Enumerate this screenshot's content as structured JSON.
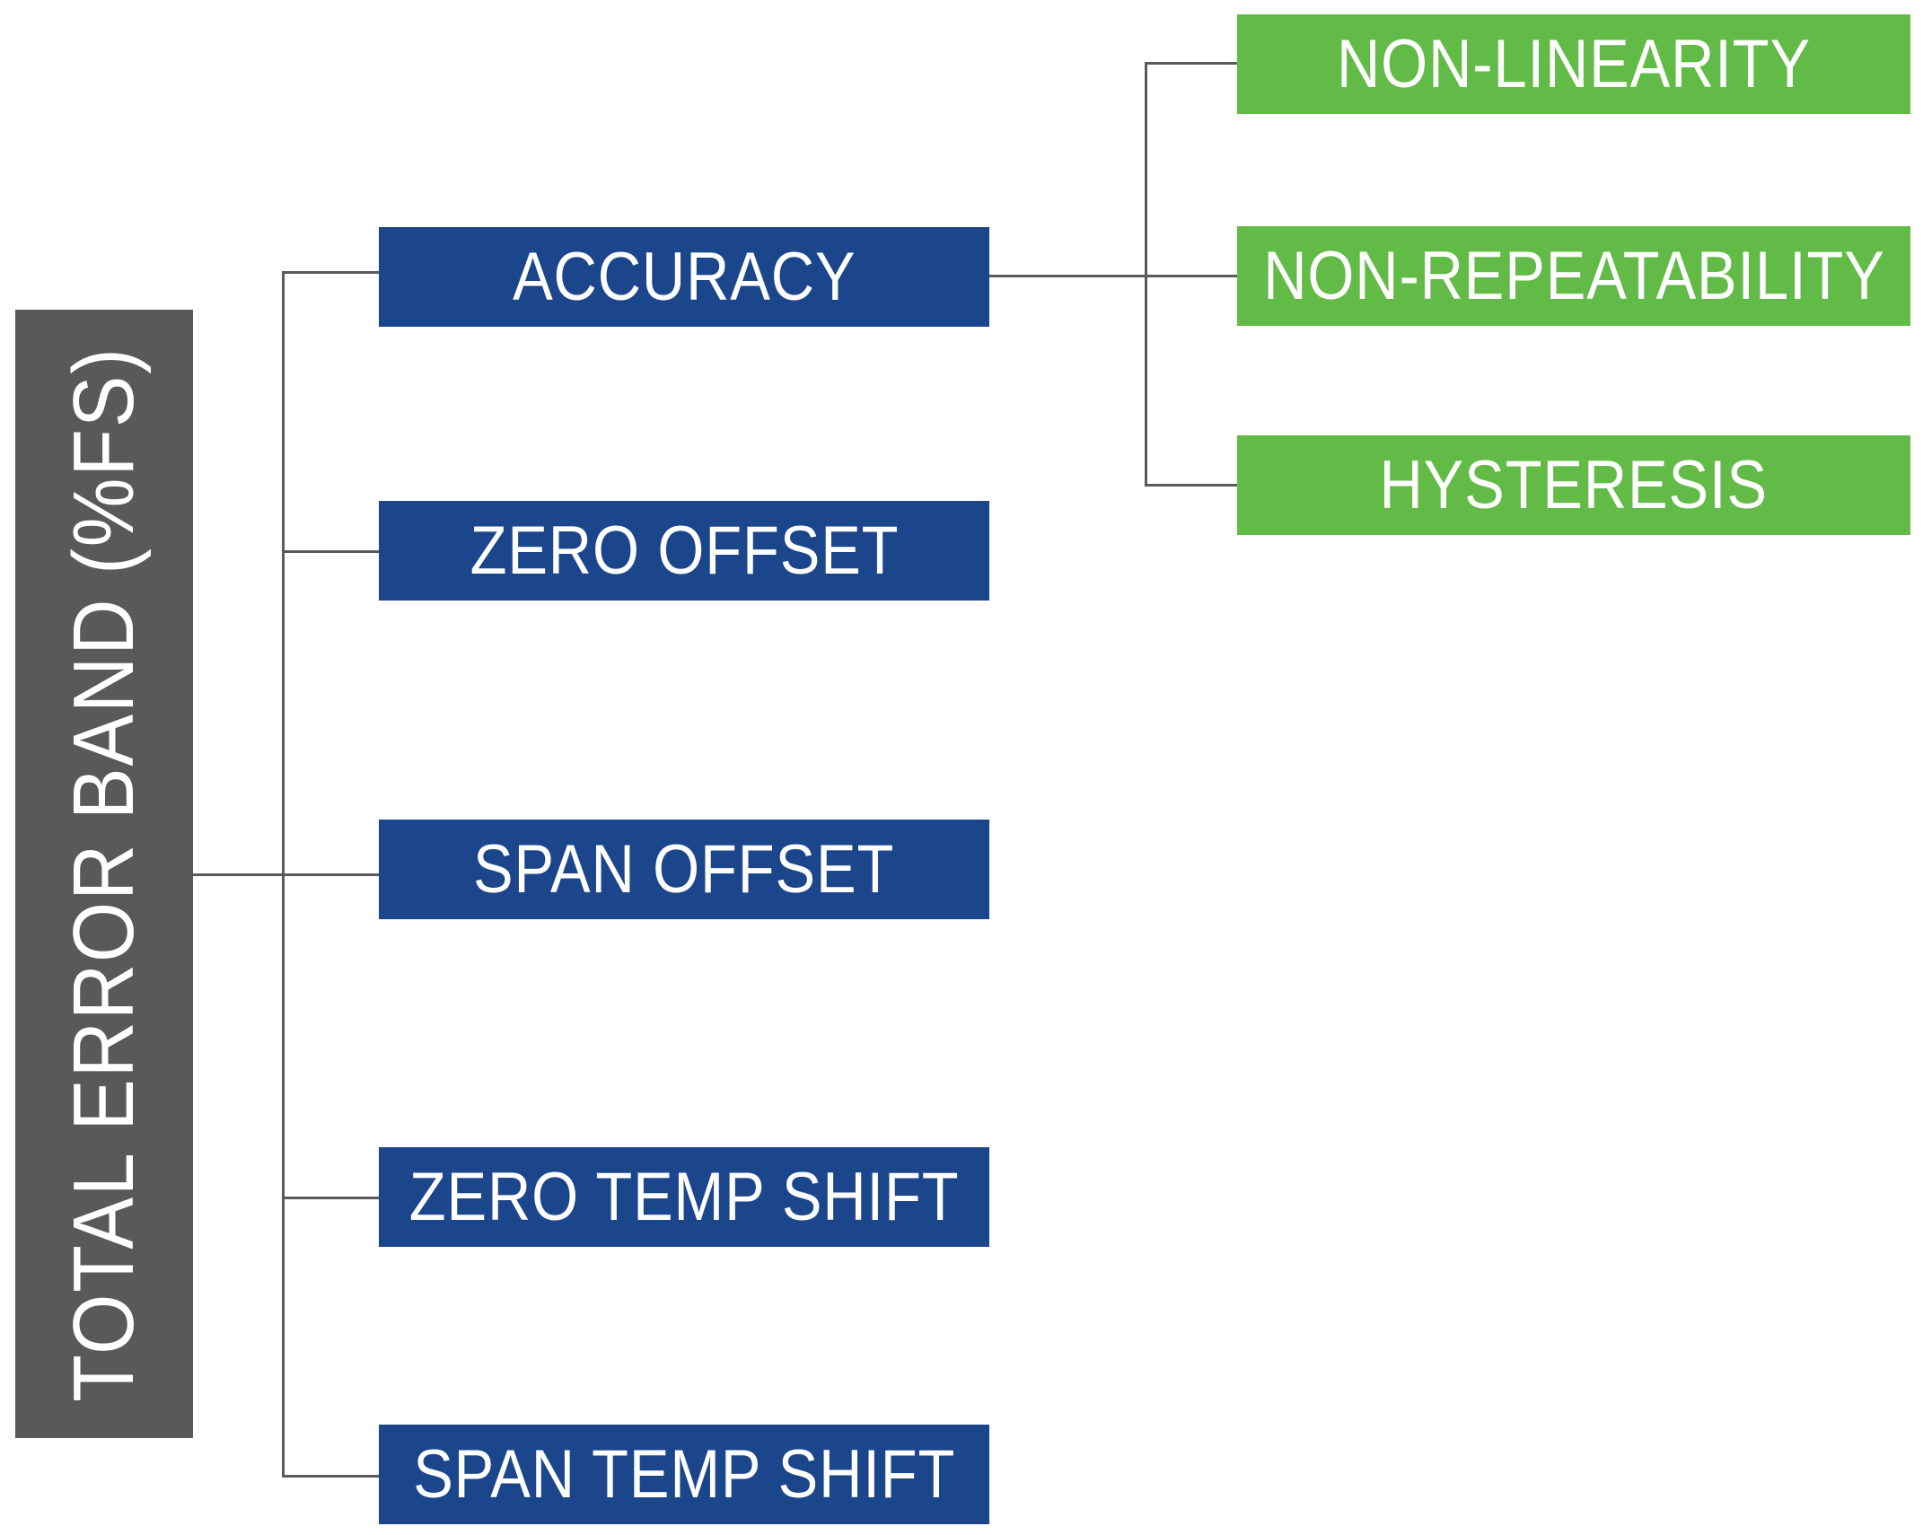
{
  "diagram": {
    "root": {
      "label": "TOTAL ERROR BAND (%FS)",
      "color": "#58595b"
    },
    "components": [
      {
        "label": "ACCURACY",
        "color": "#1c468c",
        "children": [
          {
            "label": "NON-LINEARITY",
            "color": "#63bb47"
          },
          {
            "label": "NON-REPEATABILITY",
            "color": "#63bb47"
          },
          {
            "label": "HYSTERESIS",
            "color": "#63bb47"
          }
        ]
      },
      {
        "label": "ZERO OFFSET",
        "color": "#1c468c"
      },
      {
        "label": "SPAN OFFSET",
        "color": "#1c468c"
      },
      {
        "label": "ZERO TEMP SHIFT",
        "color": "#1c468c"
      },
      {
        "label": "SPAN TEMP SHIFT",
        "color": "#1c468c"
      }
    ],
    "connector_color": "#5a5a5c"
  }
}
